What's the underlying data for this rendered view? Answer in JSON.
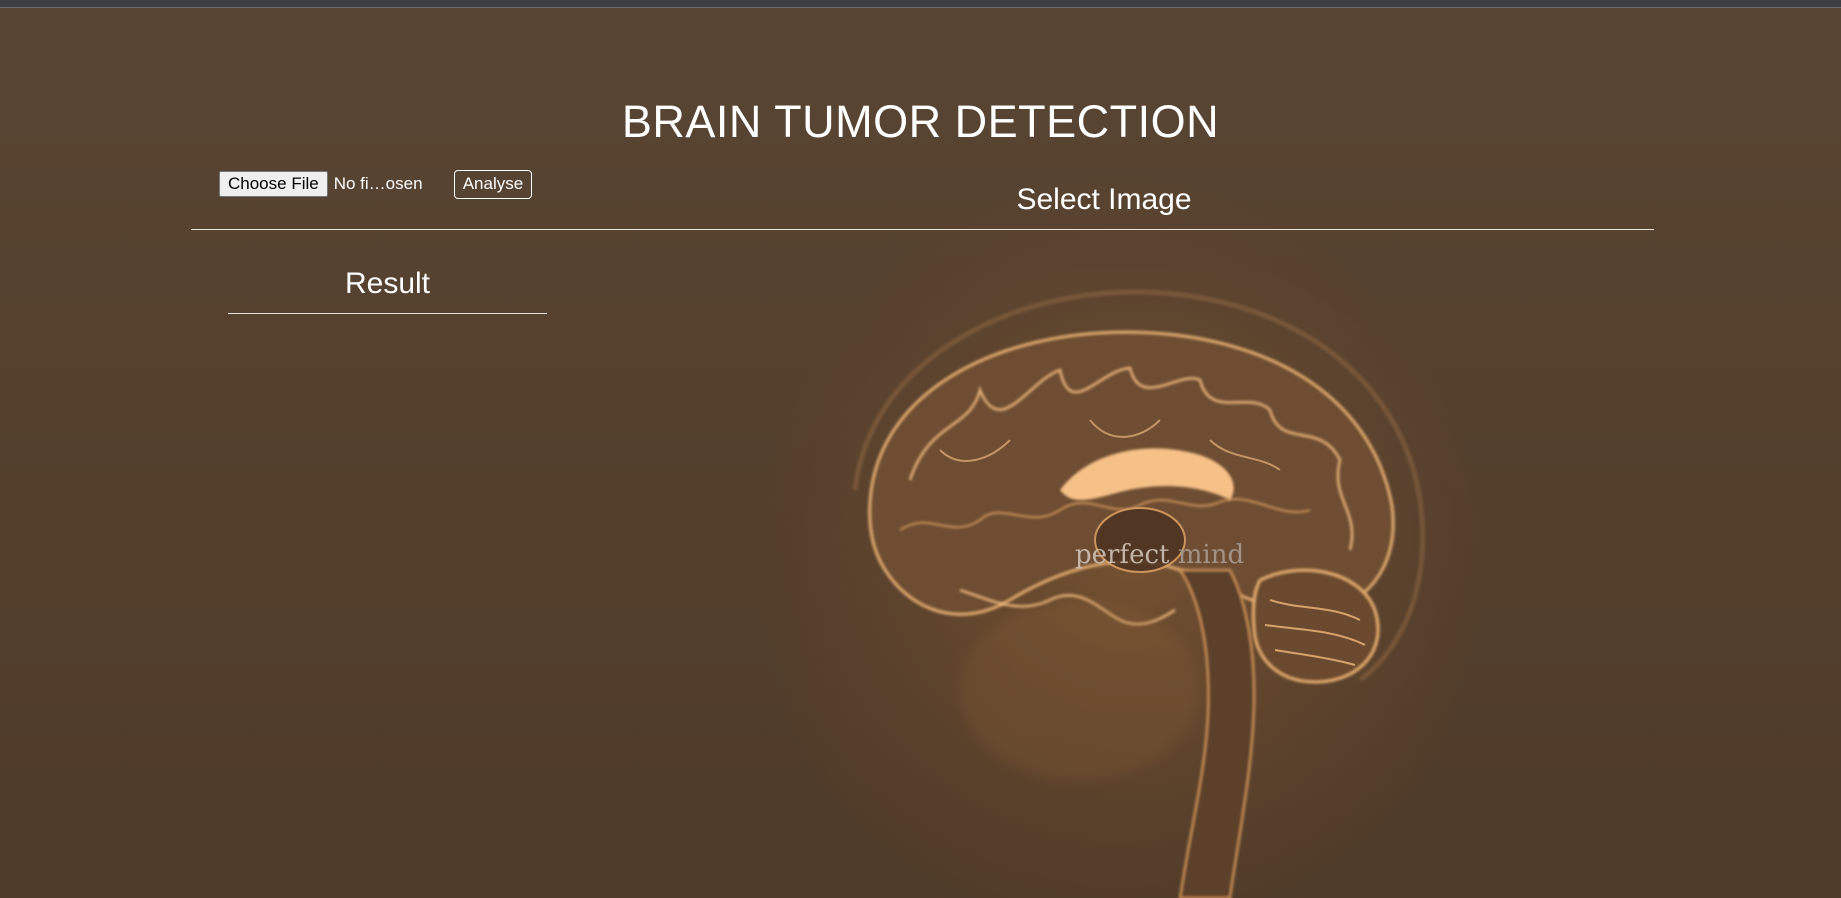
{
  "page": {
    "title": "BRAIN TUMOR DETECTION"
  },
  "upload": {
    "choose_label": "Choose File",
    "file_status": "No fi…osen",
    "analyse_label": "Analyse"
  },
  "panels": {
    "select_image_heading": "Select Image",
    "result_heading": "Result"
  },
  "background": {
    "brand_prefix": "perfect",
    "brand_suffix": "mind"
  },
  "colors": {
    "background": "#574431",
    "text": "#ffffff",
    "brain_glow": "#f3b978"
  }
}
